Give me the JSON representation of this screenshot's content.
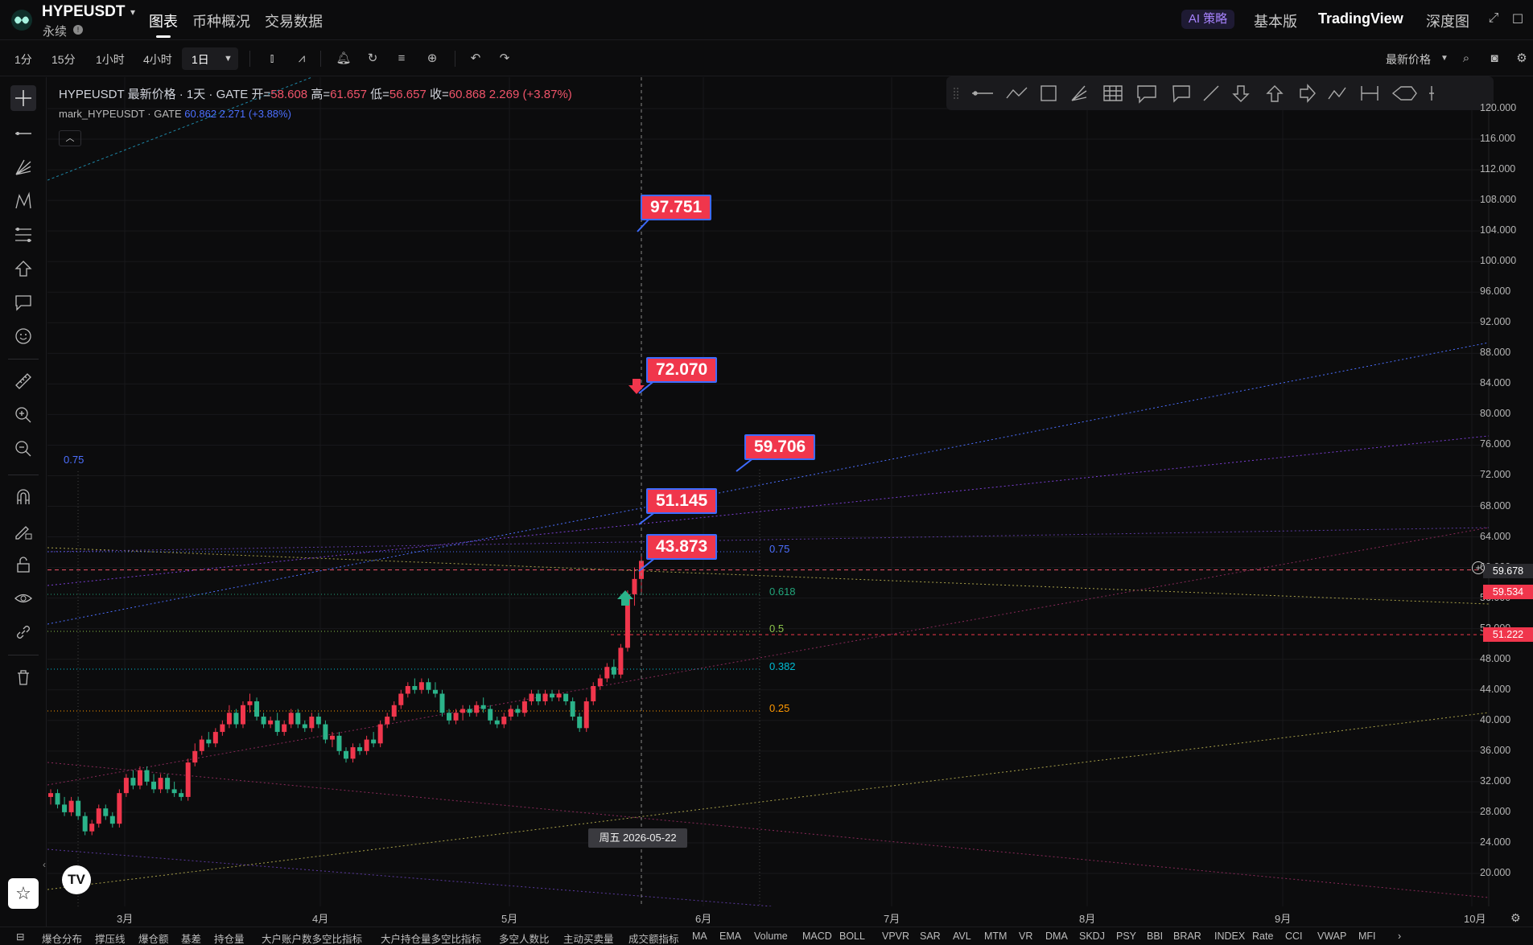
{
  "header": {
    "symbol": "HYPEUSDT",
    "subtitle": "永续",
    "tabs": [
      "图表",
      "币种概况",
      "交易数据"
    ],
    "ai_label": "AI 策略",
    "right_tabs": [
      "基本版",
      "TradingView",
      "深度图"
    ]
  },
  "toolbar": {
    "timeframes": [
      "1分",
      "15分",
      "1小时",
      "4小时"
    ],
    "selected_timeframe": "1日",
    "price_type": "最新价格"
  },
  "legend": {
    "title": "HYPEUSDT 最新价格 · 1天 · GATE",
    "open_label": "开=",
    "open": "58.608",
    "high_label": "高=",
    "high": "61.657",
    "low_label": "低=",
    "low": "56.657",
    "close_label": "收=",
    "close": "60.868",
    "change": "2.269 (+3.87%)",
    "mark_name": "mark_HYPEUSDT · GATE",
    "mark_value": "60.862",
    "mark_change": "2.271 (+3.88%)"
  },
  "callouts": [
    "97.751",
    "72.070",
    "59.706",
    "51.145",
    "43.873"
  ],
  "fib_levels": [
    {
      "label": "0.75",
      "color": "#4c6fff"
    },
    {
      "label": "0.618",
      "color": "#22a57b"
    },
    {
      "label": "0.5",
      "color": "#8bc34a"
    },
    {
      "label": "0.382",
      "color": "#00bcd4"
    },
    {
      "label": "0.25",
      "color": "#ff9800"
    }
  ],
  "fib_top_label": "0.75",
  "y_axis": [
    "120.000",
    "116.000",
    "112.000",
    "108.000",
    "104.000",
    "100.000",
    "96.000",
    "92.000",
    "88.000",
    "84.000",
    "80.000",
    "76.000",
    "72.000",
    "68.000",
    "64.000",
    "60.000",
    "56.000",
    "52.000",
    "48.000",
    "44.000",
    "40.000",
    "36.000",
    "32.000",
    "28.000",
    "24.000",
    "20.000"
  ],
  "price_tags": [
    {
      "value": "59.678",
      "color": "#2a2a2e"
    },
    {
      "value": "59.534",
      "color": "#f0364c"
    },
    {
      "value": "51.222",
      "color": "#f0364c"
    }
  ],
  "x_axis": [
    "3月",
    "4月",
    "5月",
    "6月",
    "7月",
    "8月",
    "9月",
    "10月"
  ],
  "crosshair_date": "周五 2026-05-22",
  "indicators": [
    "爆仓分布",
    "撑压线",
    "爆仓额",
    "基差",
    "持仓量",
    "大户账户数多空比指标",
    "大户持仓量多空比指标",
    "多空人数比",
    "主动买卖量",
    "成交额指标",
    "MA",
    "EMA",
    "Volume",
    "MACD",
    "BOLL",
    "VPVR",
    "SAR",
    "AVL",
    "MTM",
    "VR",
    "DMA",
    "SKDJ",
    "PSY",
    "BBI",
    "BRAR",
    "INDEX",
    "Rate",
    "CCI",
    "VWAP",
    "MFI"
  ],
  "chart_data": {
    "type": "candlestick",
    "ylim": [
      18,
      122
    ],
    "note_dates": "daily candles from late Feb 2026 to 2026-05-22",
    "candles": [
      [
        30,
        31,
        29,
        30.5
      ],
      [
        30.5,
        31,
        28.5,
        29
      ],
      [
        29,
        30,
        27.5,
        28
      ],
      [
        28,
        30,
        27.5,
        29.5
      ],
      [
        29.5,
        30,
        27,
        27.5
      ],
      [
        27.5,
        28,
        25,
        25.5
      ],
      [
        25.5,
        27,
        25,
        26.5
      ],
      [
        26.5,
        29,
        26,
        28.5
      ],
      [
        28.5,
        29,
        27,
        27.5
      ],
      [
        27.5,
        28,
        26,
        26.5
      ],
      [
        26.5,
        31,
        26,
        30.5
      ],
      [
        30.5,
        33,
        30,
        32.5
      ],
      [
        32.5,
        33.5,
        31,
        31.5
      ],
      [
        31.5,
        34,
        31,
        33.5
      ],
      [
        33.5,
        34,
        31.5,
        32
      ],
      [
        32,
        33,
        30.5,
        31
      ],
      [
        31,
        33,
        30.5,
        32.5
      ],
      [
        32.5,
        33,
        30.5,
        31
      ],
      [
        31,
        32,
        30,
        30.5
      ],
      [
        30.5,
        31,
        29.5,
        30
      ],
      [
        30,
        35,
        29.5,
        34.5
      ],
      [
        34.5,
        37,
        34,
        36
      ],
      [
        36,
        38,
        35.5,
        37.5
      ],
      [
        37.5,
        38.5,
        36.5,
        37
      ],
      [
        37,
        39,
        36.5,
        38.5
      ],
      [
        38.5,
        40,
        38,
        39.5
      ],
      [
        39.5,
        42,
        39,
        41
      ],
      [
        41,
        41.5,
        39,
        39.5
      ],
      [
        39.5,
        42.5,
        39,
        42
      ],
      [
        42,
        43.5,
        41,
        42.5
      ],
      [
        42.5,
        43,
        40,
        40.5
      ],
      [
        40.5,
        41,
        39,
        39.5
      ],
      [
        39.5,
        40.5,
        39,
        40
      ],
      [
        40,
        41,
        38,
        38.5
      ],
      [
        38.5,
        40,
        38,
        39.5
      ],
      [
        39.5,
        41.5,
        39,
        41
      ],
      [
        41,
        41.5,
        39,
        39.5
      ],
      [
        39.5,
        40,
        38.5,
        39
      ],
      [
        39,
        41,
        38.5,
        40.5
      ],
      [
        40.5,
        41,
        39,
        39.5
      ],
      [
        39.5,
        40,
        37,
        37.5
      ],
      [
        37.5,
        38.5,
        36.5,
        38
      ],
      [
        38,
        38.5,
        35.5,
        36
      ],
      [
        36,
        36.5,
        34.5,
        35
      ],
      [
        35,
        37,
        34.5,
        36.5
      ],
      [
        36.5,
        37,
        35.5,
        36
      ],
      [
        36,
        38,
        35.5,
        37.5
      ],
      [
        37.5,
        38.5,
        36.5,
        37
      ],
      [
        37,
        40,
        36.5,
        39.5
      ],
      [
        39.5,
        41,
        39,
        40.5
      ],
      [
        40.5,
        42.5,
        40,
        42
      ],
      [
        42,
        44,
        41.5,
        43.5
      ],
      [
        43.5,
        45,
        43,
        44.5
      ],
      [
        44.5,
        45.5,
        43.5,
        44
      ],
      [
        44,
        45.5,
        43.5,
        45
      ],
      [
        45,
        45.5,
        43.5,
        44
      ],
      [
        44,
        45,
        43,
        43.5
      ],
      [
        43.5,
        44,
        40.5,
        41
      ],
      [
        41,
        41.5,
        39.5,
        40
      ],
      [
        40,
        41.5,
        39.5,
        41
      ],
      [
        41,
        42,
        40,
        41.5
      ],
      [
        41.5,
        42,
        40.5,
        41
      ],
      [
        41,
        42.5,
        40.5,
        42
      ],
      [
        42,
        43,
        41,
        41.5
      ],
      [
        41.5,
        42,
        39.5,
        40
      ],
      [
        40,
        40.5,
        39,
        39.5
      ],
      [
        39.5,
        41,
        39,
        40.5
      ],
      [
        40.5,
        42,
        40,
        41.5
      ],
      [
        41.5,
        42,
        40.5,
        41
      ],
      [
        41,
        43,
        40.5,
        42.5
      ],
      [
        42.5,
        44,
        42,
        43.5
      ],
      [
        43.5,
        44,
        42,
        42.5
      ],
      [
        42.5,
        44,
        42,
        43.5
      ],
      [
        43.5,
        44,
        42.5,
        43
      ],
      [
        43,
        44,
        42.5,
        43.5
      ],
      [
        43.5,
        43.5,
        42,
        42.5
      ],
      [
        42.5,
        43,
        40,
        40.5
      ],
      [
        40.5,
        41,
        38.5,
        39
      ],
      [
        39,
        43,
        38.5,
        42.5
      ],
      [
        42.5,
        45,
        42,
        44.5
      ],
      [
        44.5,
        46,
        44,
        45.5
      ],
      [
        45.5,
        47.5,
        45,
        47
      ],
      [
        47,
        48,
        45.5,
        46
      ],
      [
        46,
        50,
        45.5,
        49.5
      ],
      [
        49.5,
        57,
        49,
        56.5
      ],
      [
        56.5,
        60,
        55,
        58.5
      ],
      [
        58.5,
        61.657,
        56.657,
        60.868
      ]
    ]
  }
}
